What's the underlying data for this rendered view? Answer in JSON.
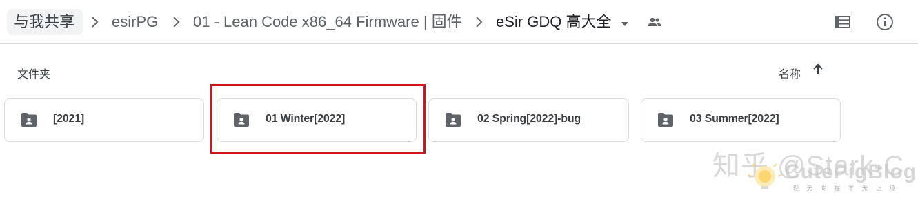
{
  "breadcrumb": {
    "items": [
      {
        "label": "与我共享"
      },
      {
        "label": "esirPG"
      },
      {
        "label": "01 - Lean Code x86_64 Firmware | 固件"
      },
      {
        "label": "eSir GDQ 高大全"
      }
    ]
  },
  "header_icons": {
    "dropdown": "caret-down-icon",
    "shared": "people-icon",
    "list_view": "list-view-icon",
    "info": "info-icon"
  },
  "section": {
    "title": "文件夹",
    "sort_label": "名称",
    "sort_icon": "arrow-up-icon"
  },
  "folders": [
    {
      "name": "[2021]",
      "highlighted": false
    },
    {
      "name": "01 Winter[2022]",
      "highlighted": true
    },
    {
      "name": "02 Spring[2022]-bug",
      "highlighted": false
    },
    {
      "name": "03 Summer[2022]",
      "highlighted": false
    }
  ],
  "colors": {
    "highlight": "#d0141d",
    "icon": "#5f6368",
    "border": "#dadce0",
    "text": "#3c4043"
  },
  "watermarks": {
    "zhihu": "知乎 @Stark-C",
    "blog": "CutePigBlog",
    "tagline": "理无专在学无止境"
  }
}
